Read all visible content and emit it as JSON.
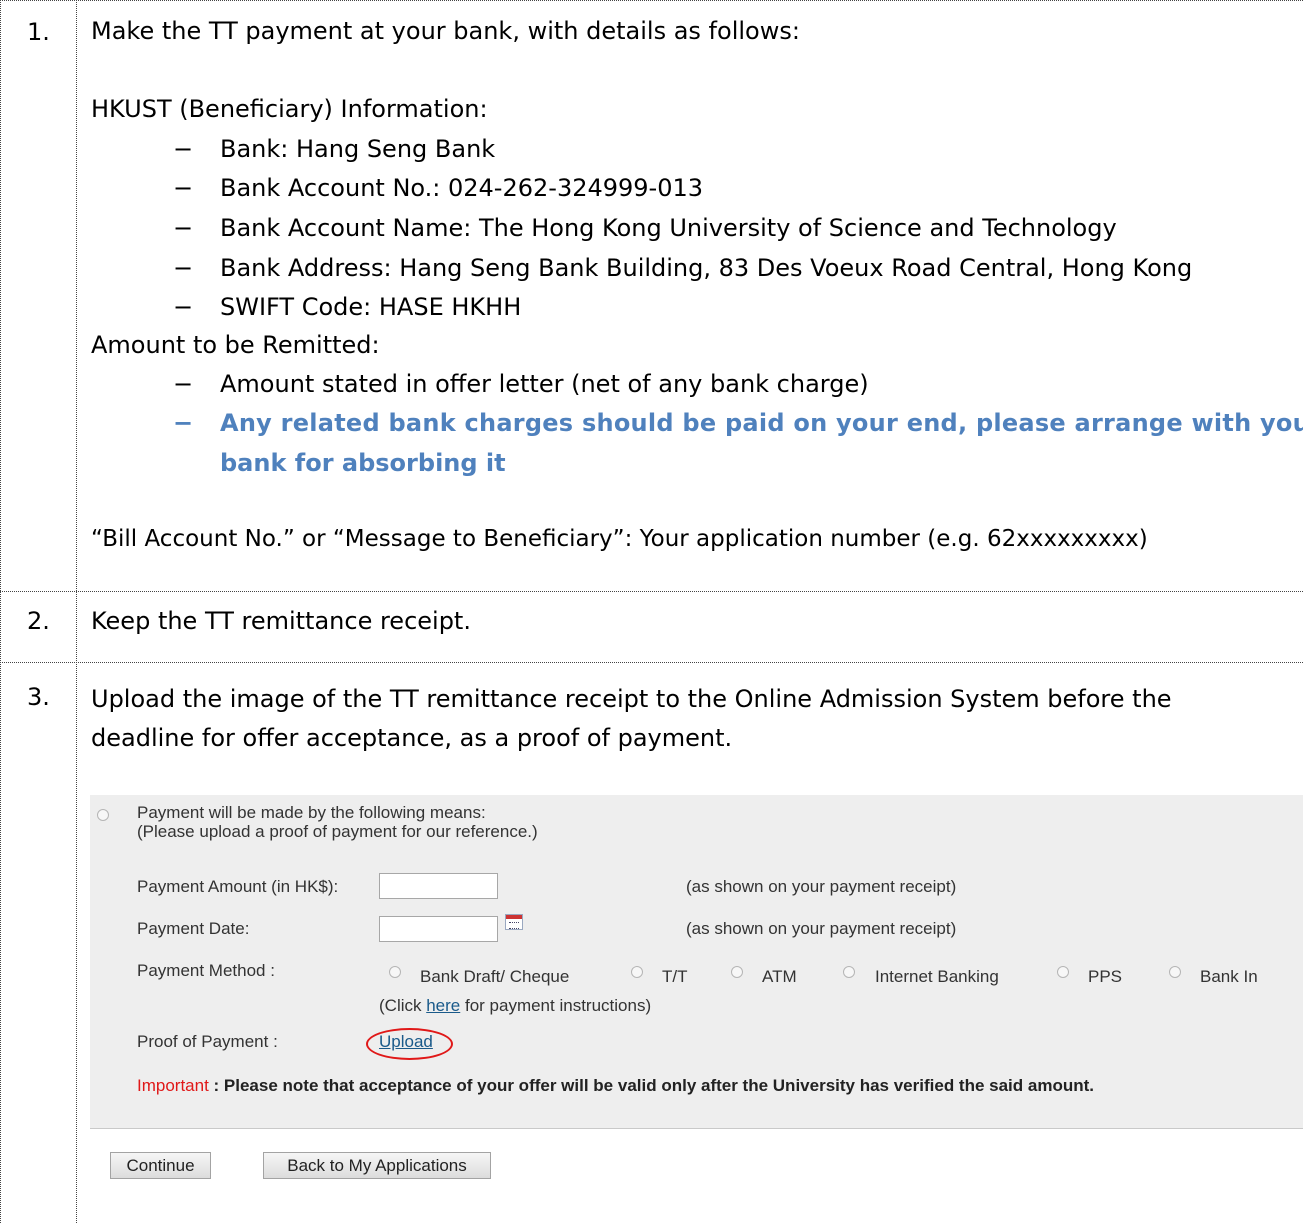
{
  "rows": [
    {
      "number": "1."
    },
    {
      "number": "2."
    },
    {
      "number": "3."
    }
  ],
  "step1": {
    "intro": "Make the TT payment at your bank, with details as follows:",
    "beneficiary_heading": "HKUST (Beneficiary) Information:",
    "bullet_symbol": "−",
    "bank_details": [
      "Bank: Hang Seng Bank",
      "Bank Account No.: 024-262-324999-013",
      "Bank Account Name: The Hong Kong University of Science and Technology",
      "Bank Address: Hang Seng Bank Building, 83 Des Voeux Road Central, Hong Kong",
      "SWIFT Code: HASE HKHH"
    ],
    "amount_heading": "Amount to be Remitted:",
    "amount_item": "Amount stated in offer letter (net of any bank charge)",
    "charges_line1": "Any related bank charges should be paid on your end, please arrange with your",
    "charges_line2": "bank for absorbing it",
    "bill_account": "“Bill Account No.” or “Message to Beneficiary”: Your application number (e.g. 62xxxxxxxxx)"
  },
  "step2": {
    "text": "Keep the TT remittance receipt."
  },
  "step3": {
    "text_line1": "Upload the image of the TT remittance receipt to the Online Admission System before the",
    "text_line2": "deadline for offer acceptance, as a proof of payment."
  },
  "form": {
    "option_line1": "Payment will be made by the following means:",
    "option_line2": "(Please upload a proof of payment for our reference.)",
    "amount_label": "Payment Amount (in HK$):",
    "amount_value": "",
    "amount_hint": "(as shown on your payment receipt)",
    "date_label": "Payment Date:",
    "date_value": "",
    "date_hint": "(as shown on your payment receipt)",
    "method_label": "Payment Method :",
    "methods": [
      "Bank Draft/ Cheque",
      "T/T",
      "ATM",
      "Internet Banking",
      "PPS",
      "Bank In"
    ],
    "click_prefix": "(Click ",
    "click_link": "here",
    "click_suffix": " for payment instructions)",
    "proof_label": "Proof of Payment :",
    "upload_link": "Upload",
    "important_label": "Important",
    "important_text": " : Please note that acceptance of your offer will be valid only after the University has verified the said amount.",
    "important_color": "#e01818",
    "continue_button": "Continue",
    "back_button": "Back to My Applications"
  }
}
